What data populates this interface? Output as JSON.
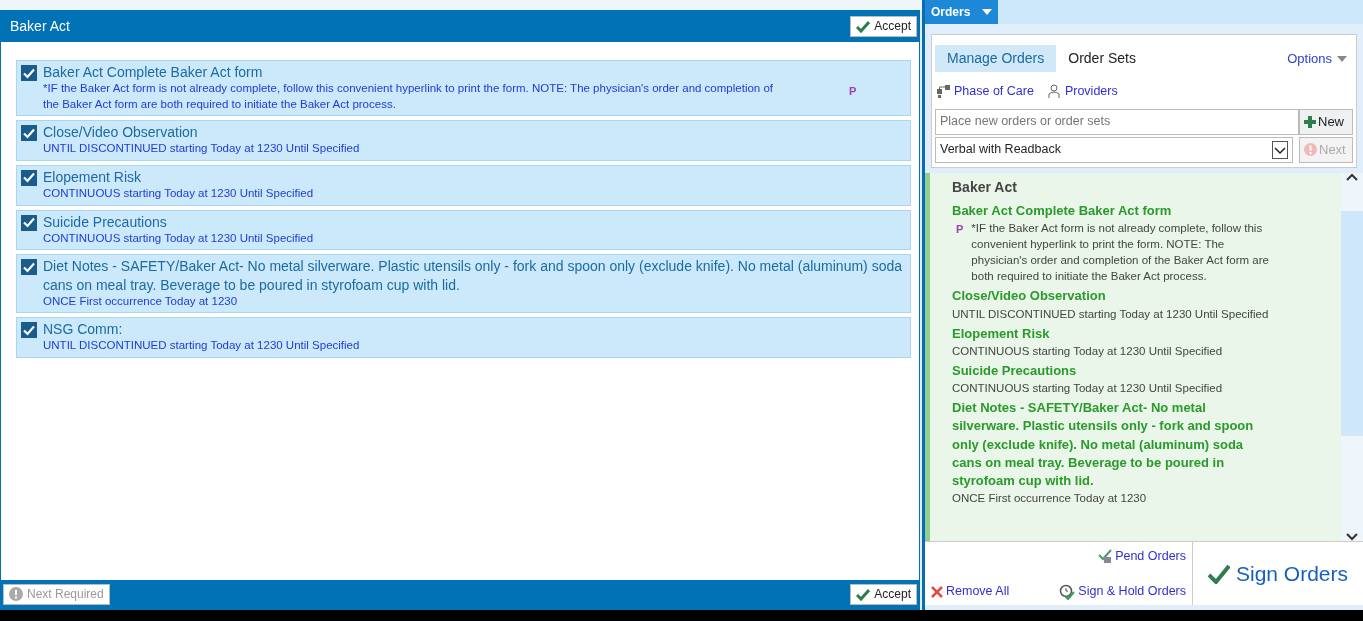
{
  "dialog": {
    "title": "Baker Act",
    "accept_top": "Accept",
    "orders": [
      {
        "checked": true,
        "title": "Baker Act Complete Baker Act form",
        "detail": "*IF the Baker Act form is not already complete, follow this convenient hyperlink to print the form. NOTE:  The physician's order and completion of the Baker Act form are both required to initiate the Baker Act process.",
        "flag": "P"
      },
      {
        "checked": true,
        "title": "Close/Video Observation",
        "detail": "UNTIL DISCONTINUED starting Today at 1230 Until Specified"
      },
      {
        "checked": true,
        "title": "Elopement Risk",
        "detail": "CONTINUOUS starting Today at 1230 Until Specified"
      },
      {
        "checked": true,
        "title": "Suicide Precautions",
        "detail": "CONTINUOUS starting Today at 1230 Until Specified"
      },
      {
        "checked": true,
        "title": "Diet Notes  - SAFETY/Baker Act- No metal silverware.  Plastic utensils only - fork and spoon only (exclude knife). No metal (aluminum) soda cans on meal tray.  Beverage to be poured in styrofoam cup with lid.",
        "detail": "ONCE First occurrence Today at 1230"
      },
      {
        "checked": true,
        "title": "NSG Comm:",
        "detail": "UNTIL DISCONTINUED starting Today at 1230 Until Specified"
      }
    ],
    "next_required": {
      "label": "Next Required",
      "disabled": true
    },
    "accept_bottom": "Accept"
  },
  "orders_panel": {
    "tab": "Orders",
    "tabs": [
      {
        "label": "Manage Orders",
        "selected": true
      },
      {
        "label": "Order Sets",
        "selected": false
      }
    ],
    "options": "Options",
    "links": [
      "Phase of Care",
      "Providers"
    ],
    "search": {
      "placeholder": "Place new orders or order sets"
    },
    "new_button": "New",
    "mode_select": "Verbal with Readback",
    "next_button": {
      "label": "Next",
      "disabled": true
    },
    "group_title": "Baker Act",
    "orders": [
      {
        "title": "Baker Act Complete Baker Act form",
        "detail": "*IF the Baker Act form is not already complete, follow this convenient hyperlink to print the form. NOTE:  The physician's order and completion of the Baker Act form are both required to initiate the Baker Act process.",
        "flag": "P"
      },
      {
        "title": "Close/Video Observation",
        "detail": "UNTIL DISCONTINUED starting Today at 1230 Until Specified"
      },
      {
        "title": "Elopement Risk",
        "detail": "CONTINUOUS starting Today at 1230 Until Specified"
      },
      {
        "title": "Suicide Precautions",
        "detail": "CONTINUOUS starting Today at 1230 Until Specified"
      },
      {
        "title": "Diet Notes  - SAFETY/Baker Act- No metal silverware.  Plastic utensils only - fork and spoon only (exclude knife). No metal (aluminum) soda cans on meal tray.  Beverage to be poured in styrofoam cup with lid.",
        "detail": "ONCE First occurrence Today at 1230"
      }
    ],
    "pend": "Pend Orders",
    "remove_all": "Remove All",
    "sign_hold": "Sign & Hold Orders",
    "sign": "Sign Orders"
  }
}
